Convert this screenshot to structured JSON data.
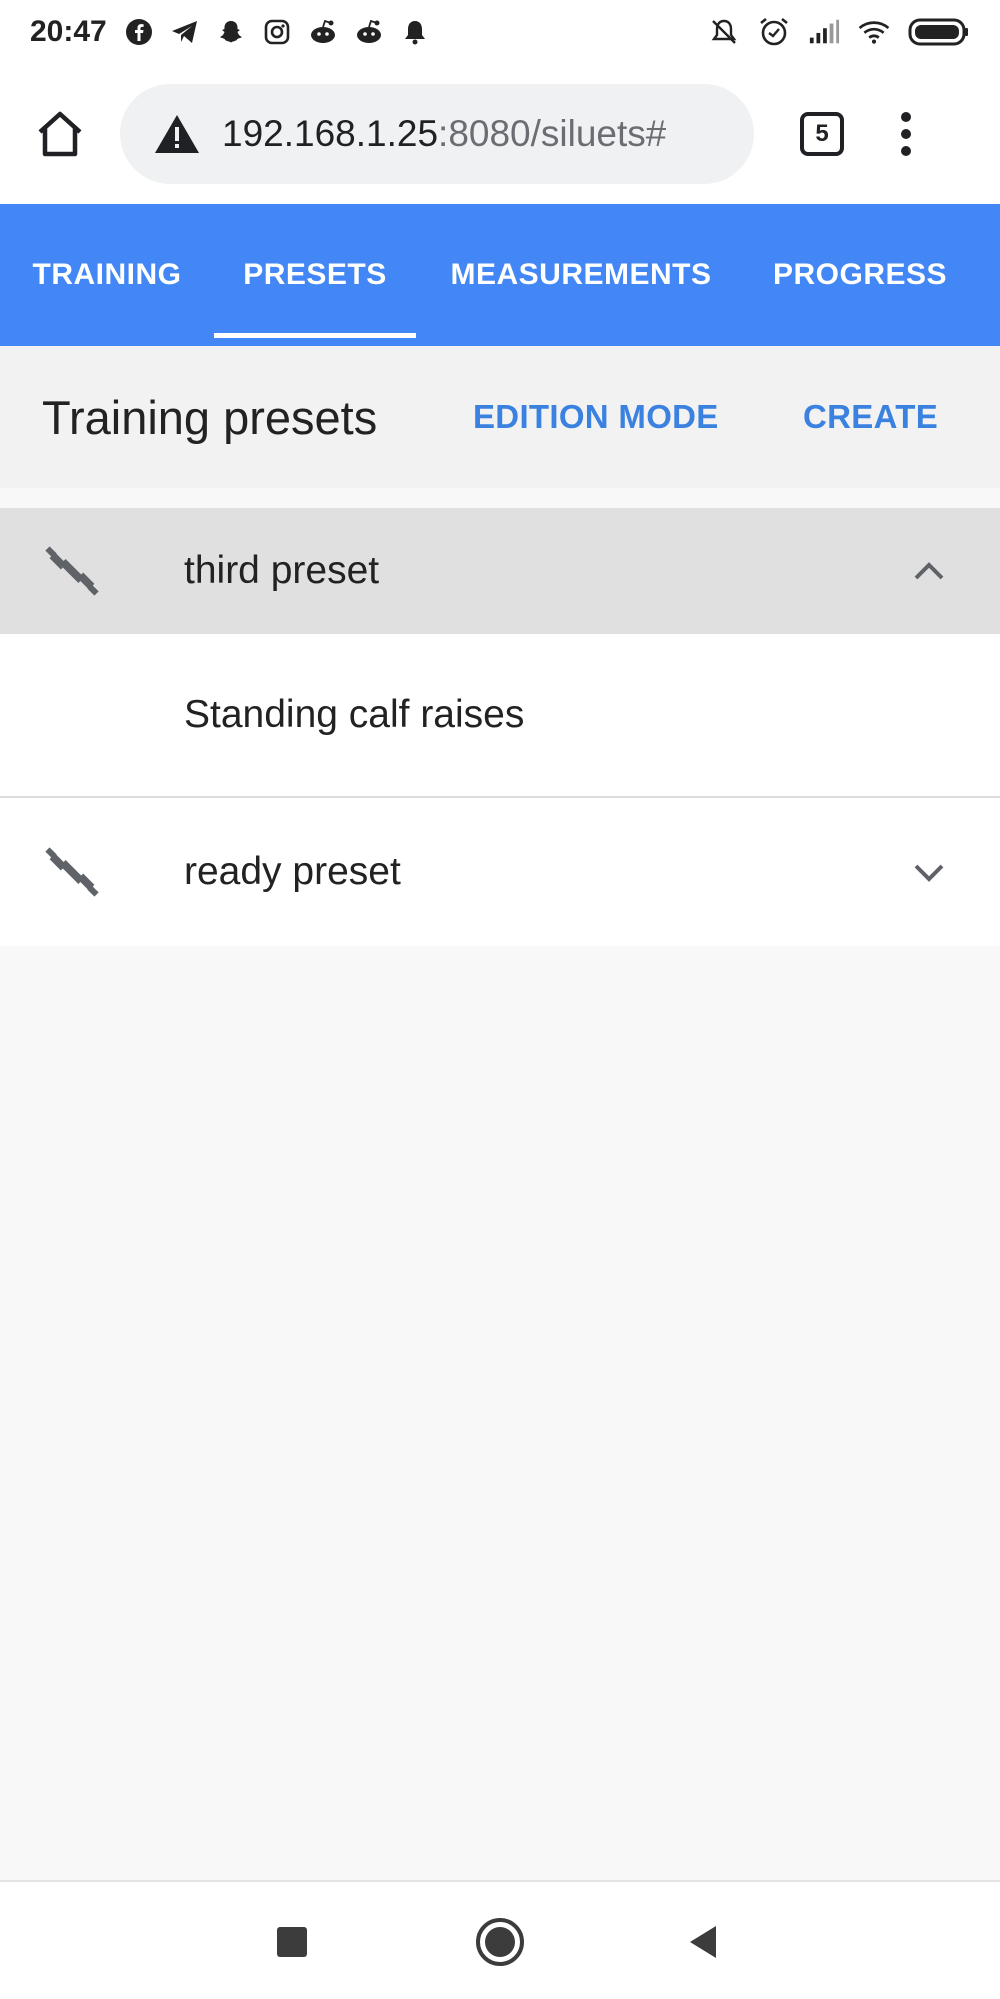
{
  "status_bar": {
    "time": "20:47",
    "left_icons": [
      "facebook-icon",
      "telegram-icon",
      "snapchat-icon",
      "instagram-icon",
      "reddit-icon",
      "reddit-icon",
      "bell-icon"
    ],
    "right_icons": [
      "bell-off-icon",
      "alarm-icon",
      "signal-icon",
      "wifi-icon",
      "battery-icon"
    ]
  },
  "browser": {
    "url_host": "192.168.1.25",
    "url_rest": ":8080/siluets#",
    "tab_count": "5",
    "home_icon": "home-icon",
    "warning_icon": "warning-icon",
    "menu_icon": "more-vert-icon"
  },
  "app_tabs": [
    {
      "label": "TRAINING",
      "active": false
    },
    {
      "label": "PRESETS",
      "active": true
    },
    {
      "label": "MEASUREMENTS",
      "active": false
    },
    {
      "label": "PROGRESS",
      "active": false
    }
  ],
  "header": {
    "title": "Training presets",
    "edition_mode_label": "EDITION MODE",
    "create_label": "CREATE"
  },
  "presets": [
    {
      "name": "third preset",
      "expanded": true,
      "exercises": [
        "Standing calf raises"
      ],
      "icon": "dumbbell-icon"
    },
    {
      "name": "ready preset",
      "expanded": false,
      "exercises": [],
      "icon": "dumbbell-icon"
    }
  ],
  "colors": {
    "app_bar": "#4287f5",
    "action_text": "#3b82e0",
    "expanded_row": "#e0e0e0",
    "background": "#f8f8f9"
  },
  "nav_bar": {
    "icons": [
      "recents-icon",
      "home-circle-icon",
      "back-icon"
    ]
  }
}
